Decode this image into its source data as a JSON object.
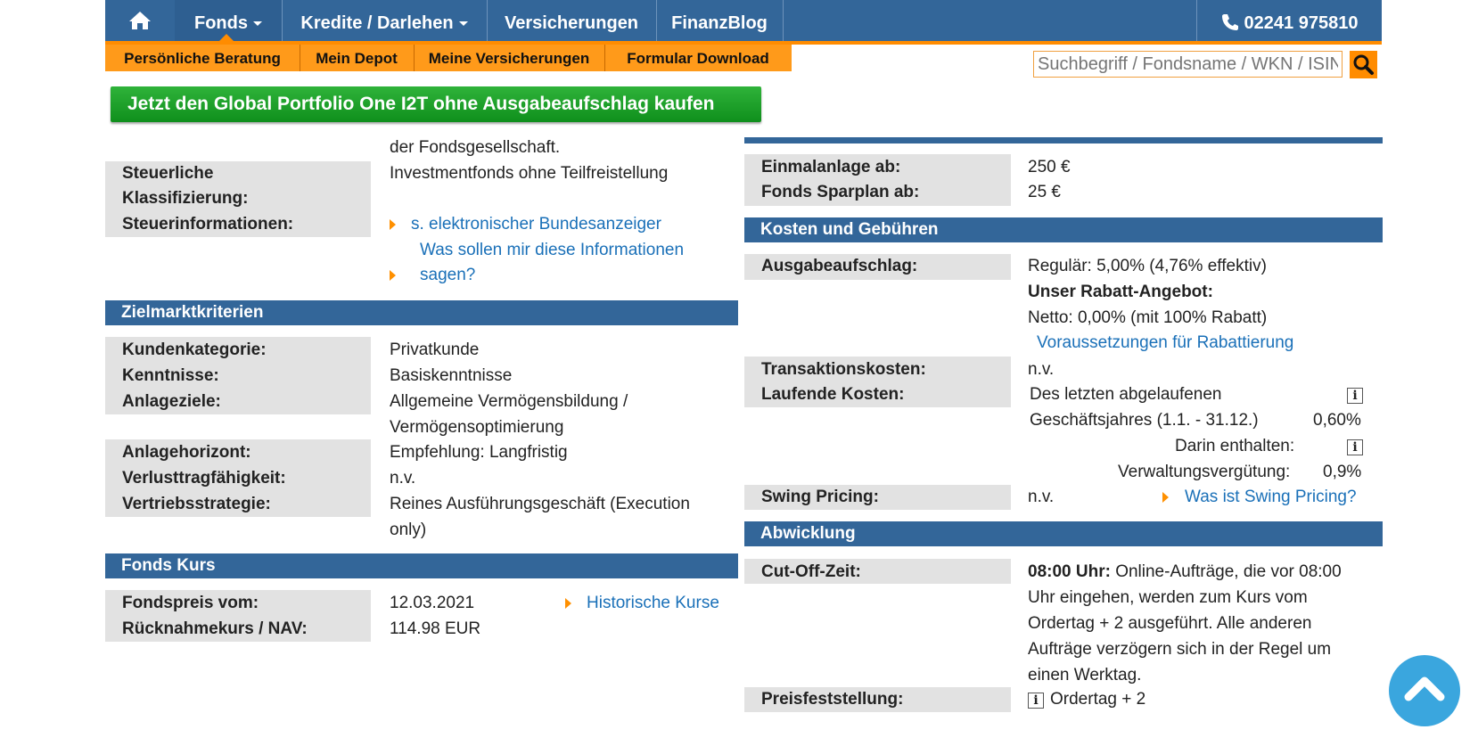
{
  "nav": {
    "home_icon": "home-icon",
    "fonds": "Fonds",
    "kredite": "Kredite / Darlehen",
    "versicherungen": "Versicherungen",
    "finanzblog": "FinanzBlog",
    "phone": "02241 975810",
    "phone_icon": "phone-icon"
  },
  "subnav": {
    "beratung": "Persönliche Beratung",
    "depot": "Mein Depot",
    "meine_vers": "Meine Versicherungen",
    "formular": "Formular Download"
  },
  "search": {
    "placeholder": "Suchbegriff / Fondsname / WKN / ISIN",
    "icon": "search-icon"
  },
  "buy_button": "Jetzt den Global Portfolio One I2T ohne Ausgabeaufschlag kaufen",
  "left": {
    "partial_text": "der Fondsgesellschaft.",
    "steuer": {
      "label_l1": "Steuerliche",
      "label_l2": "Klassifizierung:",
      "label_l3": "Steuerinformationen:",
      "value": "Investmentfonds ohne Teilfreistellung",
      "link1": "s. elektronischer Bundesanzeiger",
      "link2_l1": "Was sollen mir diese Informationen",
      "link2_l2": "sagen?"
    },
    "zielmarkt": {
      "header": "Zielmarktkriterien",
      "rows1": [
        {
          "label": "Kundenkategorie:",
          "value": "Privatkunde"
        },
        {
          "label": "Kenntnisse:",
          "value": "Basiskenntnisse"
        },
        {
          "label": "Anlageziele:",
          "value": "Allgemeine Vermögensbildung /"
        }
      ],
      "anlageziele_l2": "Vermögensoptimierung",
      "rows2": [
        {
          "label": "Anlagehorizont:",
          "value": "Empfehlung: Langfristig"
        },
        {
          "label": "Verlusttragfähigkeit:",
          "value": "n.v."
        },
        {
          "label": "Vertriebsstrategie:",
          "value": "Reines Ausführungsgeschäft (Execution"
        }
      ],
      "vertrieb_l2": "only)"
    },
    "kurs": {
      "header": "Fonds Kurs",
      "label1": "Fondspreis vom:",
      "value1": "12.03.2021",
      "link": "Historische Kurse",
      "label2": "Rücknahmekurs / NAV:",
      "value2": "114.98 EUR"
    }
  },
  "right": {
    "anlage": {
      "label1": "Einmalanlage ab:",
      "value1": "250 €",
      "label2": "Fonds Sparplan ab:",
      "value2": "25 €"
    },
    "kosten": {
      "header": "Kosten und Gebühren",
      "ausgabe_label": "Ausgabeaufschlag:",
      "regulaer": "Regulär: 5,00% (4,76% effektiv)",
      "rabatt_title": "Unser Rabatt-Angebot:",
      "netto": "Netto: 0,00% (mit 100% Rabatt)",
      "voraussetzungen": "Voraussetzungen für Rabattierung",
      "trans_label": "Transaktionskosten:",
      "trans_value": "n.v.",
      "laufend_label": "Laufende Kosten:",
      "laufend_l1": "Des letzten abgelaufenen",
      "laufend_l2": "Geschäftsjahres (1.1. - 31.12.)",
      "laufend_pct": "0,60%",
      "darin": "Darin enthalten:",
      "verwaltung": "Verwaltungsvergütung:",
      "verwaltung_pct": "0,9%",
      "swing_label": "Swing Pricing:",
      "swing_value": "n.v.",
      "swing_link": "Was ist Swing Pricing?",
      "info_glyph": "i"
    },
    "abwicklung": {
      "header": "Abwicklung",
      "cutoff_label": "Cut-Off-Zeit:",
      "cutoff_bold": "08:00 Uhr:",
      "cutoff_l1": "Online-Aufträge, die vor 08:00",
      "cutoff_l2": "Uhr eingehen, werden zum Kurs vom",
      "cutoff_l3": "Ordertag + 2 ausgeführt. Alle anderen",
      "cutoff_l4": "Aufträge verzögern sich in der Regel um",
      "cutoff_l5": "einen Werktag.",
      "preis_label": "Preisfeststellung:",
      "preis_value": "Ordertag + 2"
    }
  },
  "scroll_top_icon": "chevron-up-icon"
}
